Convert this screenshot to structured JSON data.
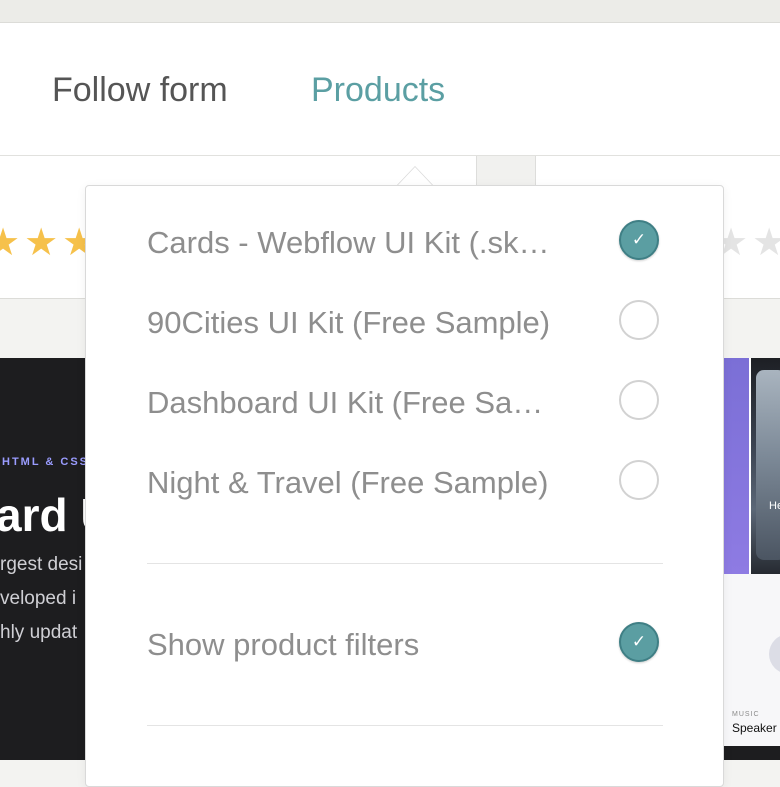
{
  "tabs": {
    "follow_form": "Follow form",
    "products": "Products"
  },
  "ratings": {
    "left_stars": "★★★",
    "right_stars": "★★"
  },
  "preview_left": {
    "kicker": "HTML & CSS",
    "headline": "ard U",
    "lines": [
      "rgest desi",
      "veloped i",
      "hly updat"
    ]
  },
  "preview_right": {
    "photo_text": "He",
    "music_kicker": "MUSIC",
    "music_title": "Speaker"
  },
  "dropdown": {
    "items": [
      {
        "label": "Cards - Webflow UI Kit (.sk…",
        "checked": true
      },
      {
        "label": "90Cities UI Kit (Free Sample)",
        "checked": false
      },
      {
        "label": "Dashboard UI Kit (Free Sa…",
        "checked": false
      },
      {
        "label": "Night & Travel (Free Sample)",
        "checked": false
      }
    ],
    "show_filters_label": "Show product filters",
    "show_filters_checked": true,
    "check_glyph": "✓"
  },
  "colors": {
    "accent": "#5b9fa3",
    "check_fill": "#5b9ea2",
    "star": "#f6c14b"
  }
}
